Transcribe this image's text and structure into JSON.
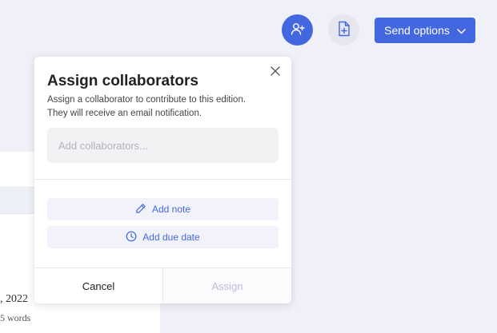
{
  "toolbar": {
    "add_collaborator_icon": "user-plus-icon",
    "new_document_icon": "file-plus-icon",
    "send_options_label": "Send options",
    "send_options_icon": "chevron-down-icon"
  },
  "background": {
    "date_fragment": ", 2022",
    "words_fragment": "5 words"
  },
  "modal": {
    "title": "Assign collaborators",
    "description_line1": "Assign a collaborator to contribute to this edition.",
    "description_line2": "They will receive an email notification.",
    "collaborator_input": {
      "value": "",
      "placeholder": "Add collaborators..."
    },
    "add_note_label": "Add note",
    "add_due_date_label": "Add due date",
    "cancel_label": "Cancel",
    "assign_label": "Assign"
  },
  "colors": {
    "accent": "#4367e0",
    "disabled_text": "#b9bdd8",
    "page_background": "#f0f0f8"
  }
}
